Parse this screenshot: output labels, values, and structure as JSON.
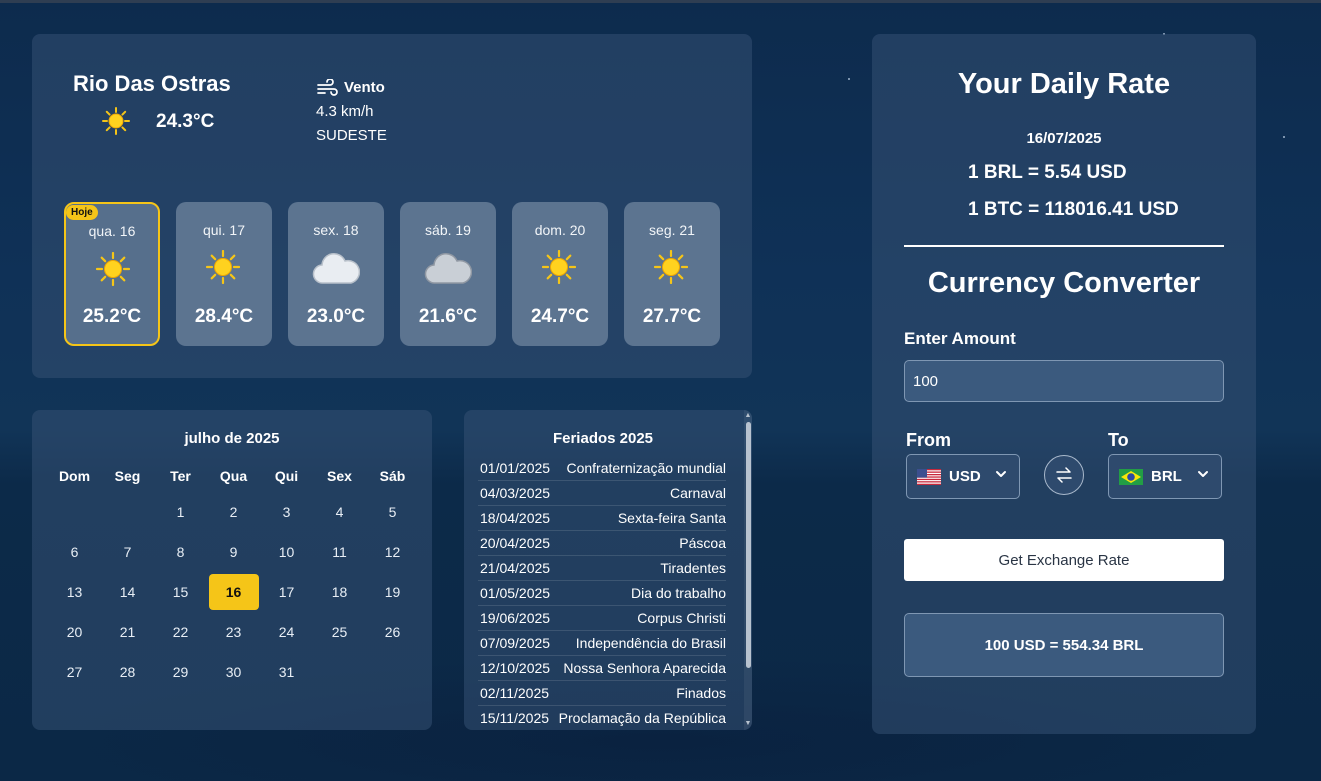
{
  "weather": {
    "city": "Rio Das Ostras",
    "current_temp": "24.3°C",
    "wind_title": "Vento",
    "wind_speed": "4.3 km/h",
    "wind_direction": "SUDESTE",
    "today_badge": "Hoje",
    "forecast": [
      {
        "day": "qua. 16",
        "temp": "25.2°C",
        "icon": "sun-icon"
      },
      {
        "day": "qui. 17",
        "temp": "28.4°C",
        "icon": "sun-icon"
      },
      {
        "day": "sex. 18",
        "temp": "23.0°C",
        "icon": "cloud-icon"
      },
      {
        "day": "sáb. 19",
        "temp": "21.6°C",
        "icon": "cloud-icon"
      },
      {
        "day": "dom. 20",
        "temp": "24.7°C",
        "icon": "sun-icon"
      },
      {
        "day": "seg. 21",
        "temp": "27.7°C",
        "icon": "sun-icon"
      }
    ]
  },
  "calendar": {
    "title": "julho de 2025",
    "weekdays": [
      "Dom",
      "Seg",
      "Ter",
      "Qua",
      "Qui",
      "Sex",
      "Sáb"
    ],
    "today": "16",
    "weeks": [
      [
        "",
        "",
        "1",
        "2",
        "3",
        "4",
        "5"
      ],
      [
        "6",
        "7",
        "8",
        "9",
        "10",
        "11",
        "12"
      ],
      [
        "13",
        "14",
        "15",
        "16",
        "17",
        "18",
        "19"
      ],
      [
        "20",
        "21",
        "22",
        "23",
        "24",
        "25",
        "26"
      ],
      [
        "27",
        "28",
        "29",
        "30",
        "31",
        "",
        ""
      ]
    ]
  },
  "holidays": {
    "title": "Feriados 2025",
    "items": [
      {
        "date": "01/01/2025",
        "name": "Confraternização mundial"
      },
      {
        "date": "04/03/2025",
        "name": "Carnaval"
      },
      {
        "date": "18/04/2025",
        "name": "Sexta-feira Santa"
      },
      {
        "date": "20/04/2025",
        "name": "Páscoa"
      },
      {
        "date": "21/04/2025",
        "name": "Tiradentes"
      },
      {
        "date": "01/05/2025",
        "name": "Dia do trabalho"
      },
      {
        "date": "19/06/2025",
        "name": "Corpus Christi"
      },
      {
        "date": "07/09/2025",
        "name": "Independência do Brasil"
      },
      {
        "date": "12/10/2025",
        "name": "Nossa Senhora Aparecida"
      },
      {
        "date": "02/11/2025",
        "name": "Finados"
      },
      {
        "date": "15/11/2025",
        "name": "Proclamação da República"
      }
    ]
  },
  "currency": {
    "title": "Your Daily Rate",
    "date": "16/07/2025",
    "rate_brl": "1 BRL = 5.54 USD",
    "rate_btc": "1 BTC = 118016.41 USD",
    "converter_title": "Currency Converter",
    "amount_label": "Enter Amount",
    "amount_value": "100",
    "from_label": "From",
    "to_label": "To",
    "from_currency": "USD",
    "to_currency": "BRL",
    "button_label": "Get Exchange Rate",
    "result": "100 USD = 554.34 BRL"
  },
  "colors": {
    "accent": "#f5c518",
    "background": "#0f3157",
    "panel": "#345072"
  }
}
